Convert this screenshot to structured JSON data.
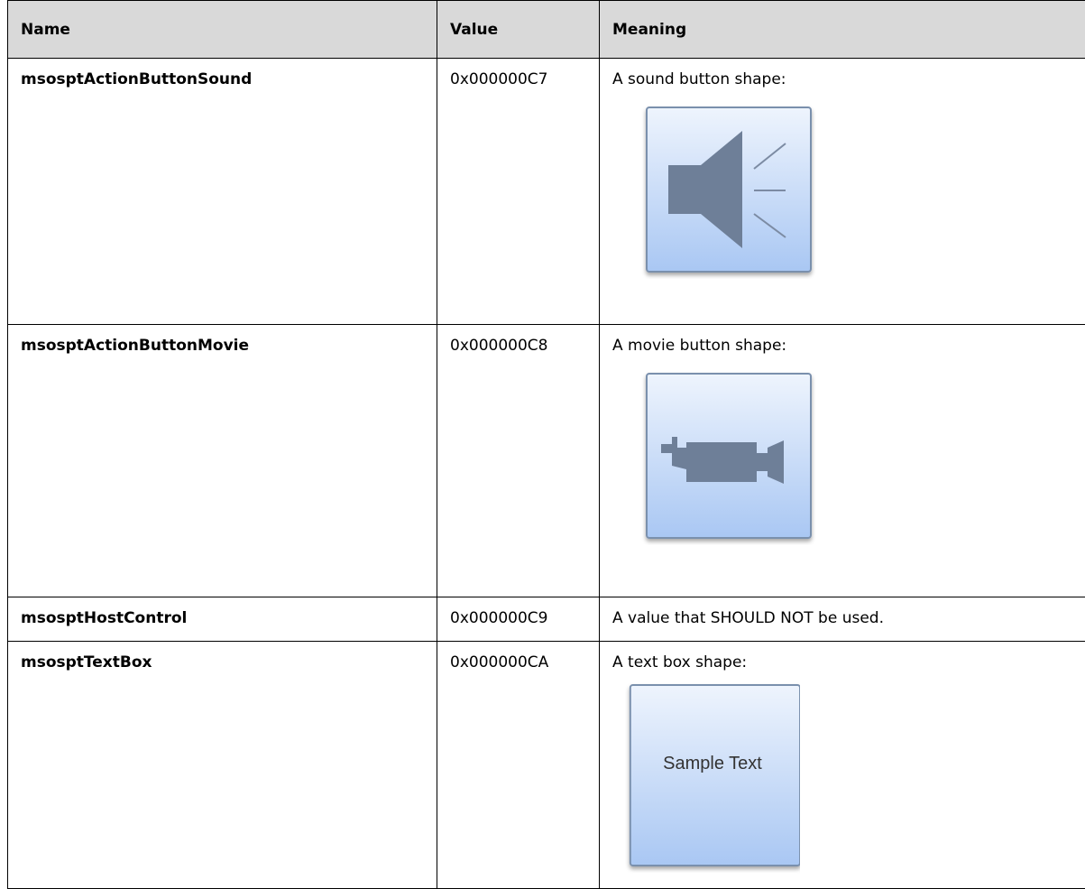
{
  "table": {
    "headers": {
      "name": "Name",
      "value": "Value",
      "meaning": "Meaning"
    },
    "rows": [
      {
        "name": "msosptActionButtonSound",
        "value": "0x000000C7",
        "meaning": "A sound button shape:",
        "shape_icon": "speaker-icon"
      },
      {
        "name": "msosptActionButtonMovie",
        "value": "0x000000C8",
        "meaning": "A movie button shape:",
        "shape_icon": "movie-camera-icon"
      },
      {
        "name": "msosptHostControl",
        "value": "0x000000C9",
        "meaning": "A value that SHOULD NOT be used."
      },
      {
        "name": "msosptTextBox",
        "value": "0x000000CA",
        "meaning": "A text box shape:",
        "shape_text": "Sample Text"
      }
    ]
  },
  "colors": {
    "header_background": "#d9d9d9",
    "button_gradient_top": "#eef4fd",
    "button_gradient_bottom": "#a9c7f3",
    "button_border": "#7a90ad",
    "glyph": "#6e7f98"
  }
}
